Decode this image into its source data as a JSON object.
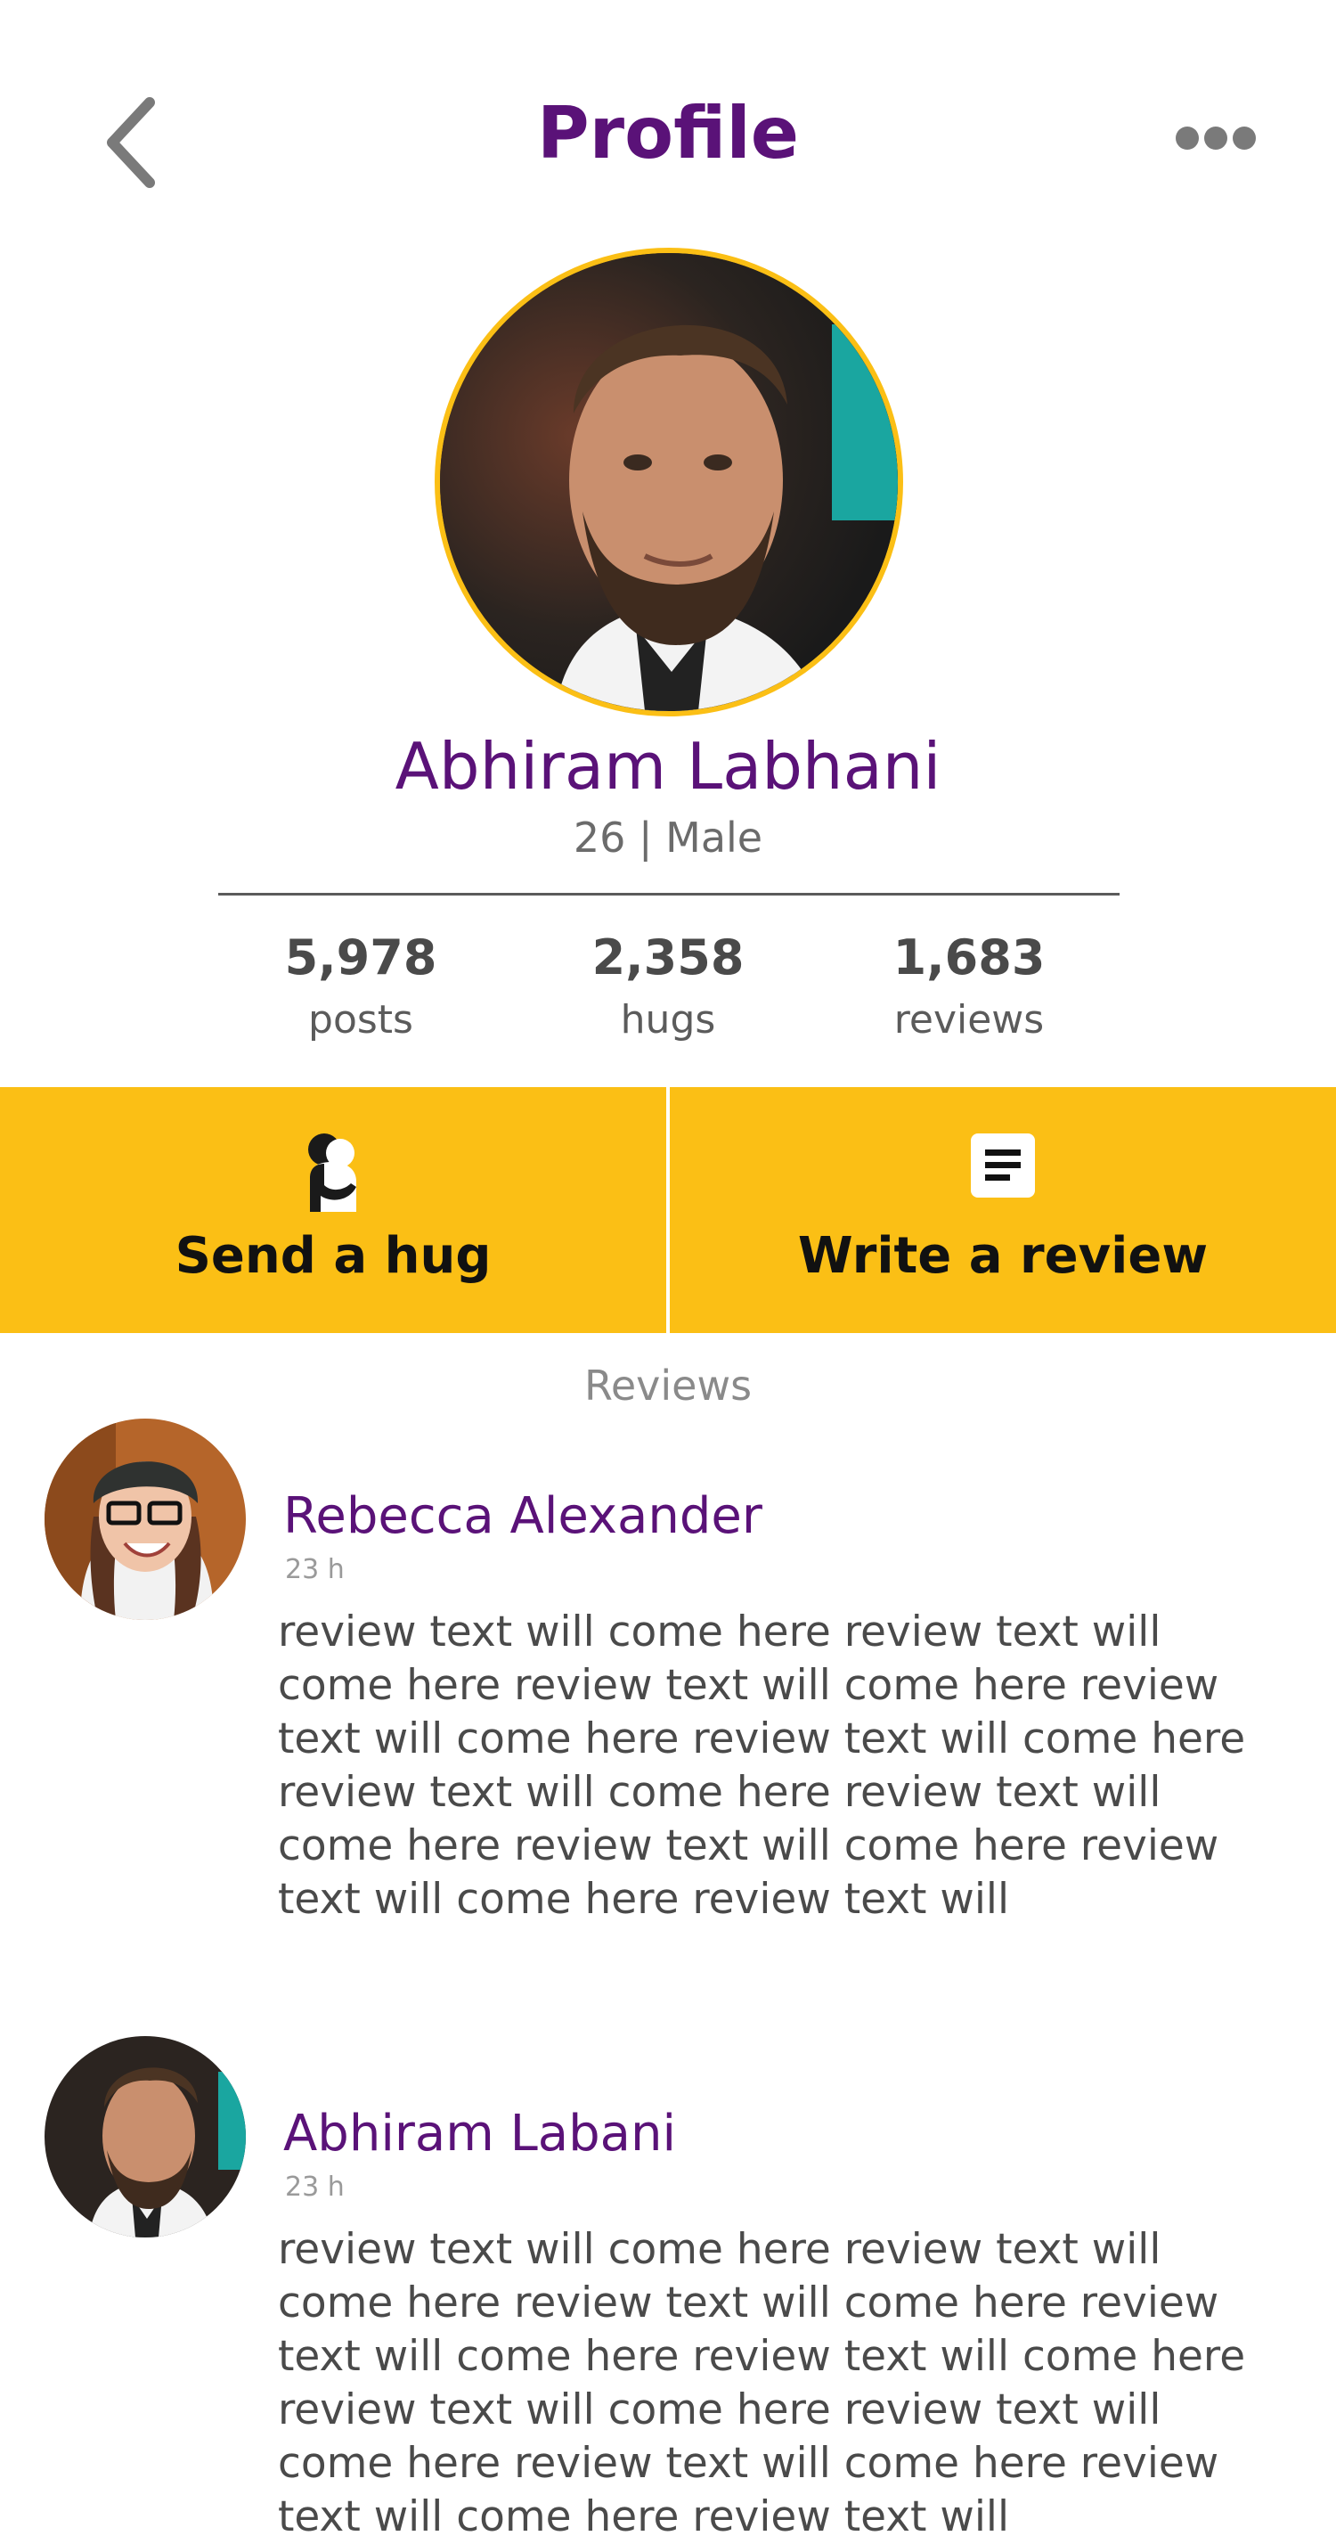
{
  "header": {
    "title": "Profile",
    "back_icon": "chevron-left-icon",
    "more_icon": "more-horizontal-icon"
  },
  "profile": {
    "name": "Abhiram Labhani",
    "meta": "26 | Male",
    "avatar_ring_color": "#fbbf15"
  },
  "stats": [
    {
      "value": "5,978",
      "label": "posts"
    },
    {
      "value": "2,358",
      "label": "hugs"
    },
    {
      "value": "1,683",
      "label": "reviews"
    }
  ],
  "actions": {
    "send_hug": "Send a hug",
    "write_review": "Write a review",
    "hug_icon": "hug-icon",
    "review_icon": "document-icon",
    "bar_color": "#fbbf15"
  },
  "reviews": {
    "heading": "Reviews",
    "items": [
      {
        "name": "Rebecca Alexander",
        "time": "23 h",
        "text": "review text will come here review text will come here review text will come here review text will come here review text will come here review text will come here review text will come here review text will come here review text will come here review text will"
      },
      {
        "name": "Abhiram Labani",
        "time": "23 h",
        "text": "review text will come here review text will come here review text will come here review text will come here review text will come here review text will come here review text will come here review text will come here review text will come here review text will"
      }
    ]
  },
  "colors": {
    "accent_purple": "#5a1278",
    "accent_yellow": "#fbbf15"
  }
}
